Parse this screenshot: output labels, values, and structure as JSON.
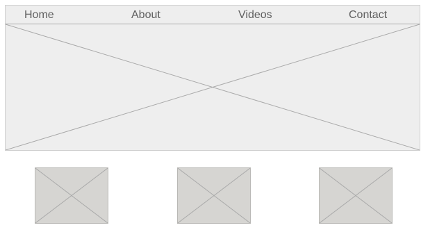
{
  "nav": {
    "items": [
      {
        "label": "Home"
      },
      {
        "label": "About"
      },
      {
        "label": "Videos"
      },
      {
        "label": "Contact"
      }
    ]
  },
  "colors": {
    "nav_background": "#eeeeee",
    "nav_text": "#5f5f5f",
    "placeholder_light": "#eeeeee",
    "placeholder_dark": "#d6d5d2",
    "placeholder_lines": "#a9a9a9"
  },
  "hero": {
    "icon": "image-placeholder-icon"
  },
  "thumbnails": [
    {
      "icon": "image-placeholder-icon"
    },
    {
      "icon": "image-placeholder-icon"
    },
    {
      "icon": "image-placeholder-icon"
    }
  ]
}
